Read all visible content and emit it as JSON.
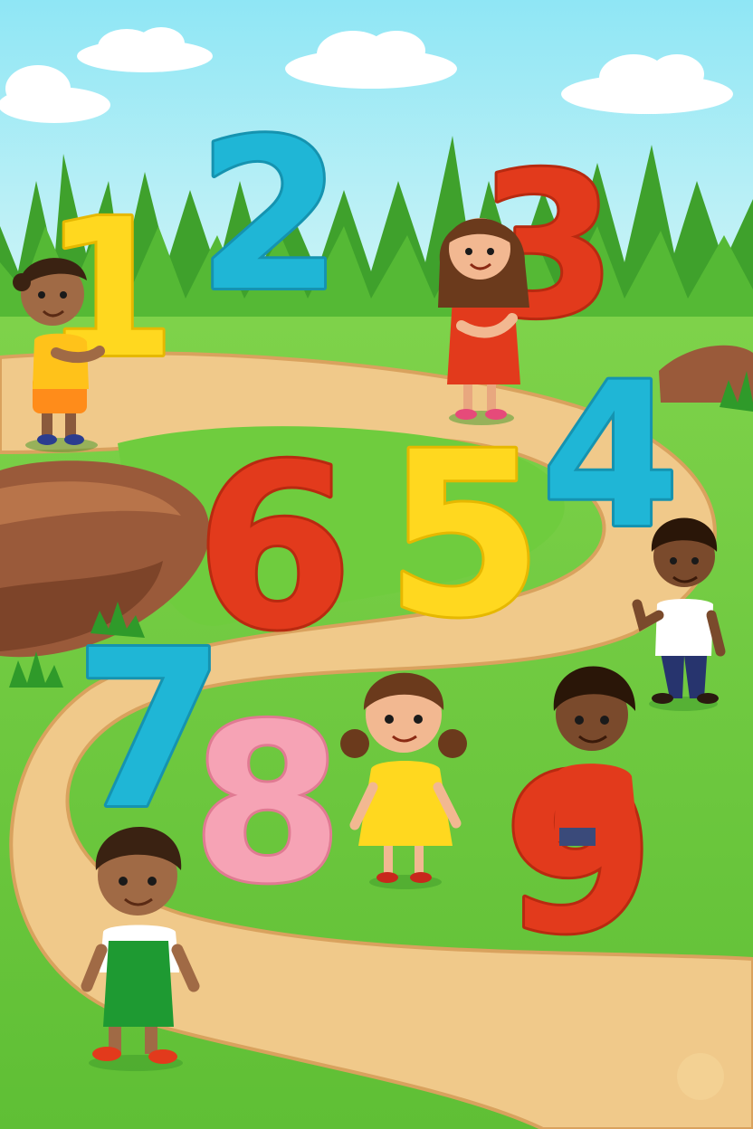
{
  "scene": {
    "colors": {
      "sky_top": "#8fe6f5",
      "sky_bottom": "#cdf4f7",
      "grass": "#6fcc3e",
      "grass_dark": "#3fa62a",
      "path": "#f0c98a",
      "path_edge": "#d9a25e",
      "rock": "#9a5a3a"
    },
    "numbers": [
      {
        "value": "1",
        "color": "#ffd81f"
      },
      {
        "value": "2",
        "color": "#1fb6d6"
      },
      {
        "value": "3",
        "color": "#e23a1c"
      },
      {
        "value": "4",
        "color": "#1fb6d6"
      },
      {
        "value": "5",
        "color": "#ffd81f"
      },
      {
        "value": "6",
        "color": "#e23a1c"
      },
      {
        "value": "7",
        "color": "#1fb6d6"
      },
      {
        "value": "8",
        "color": "#f6a3b5"
      },
      {
        "value": "9",
        "color": "#e23a1c"
      }
    ]
  }
}
